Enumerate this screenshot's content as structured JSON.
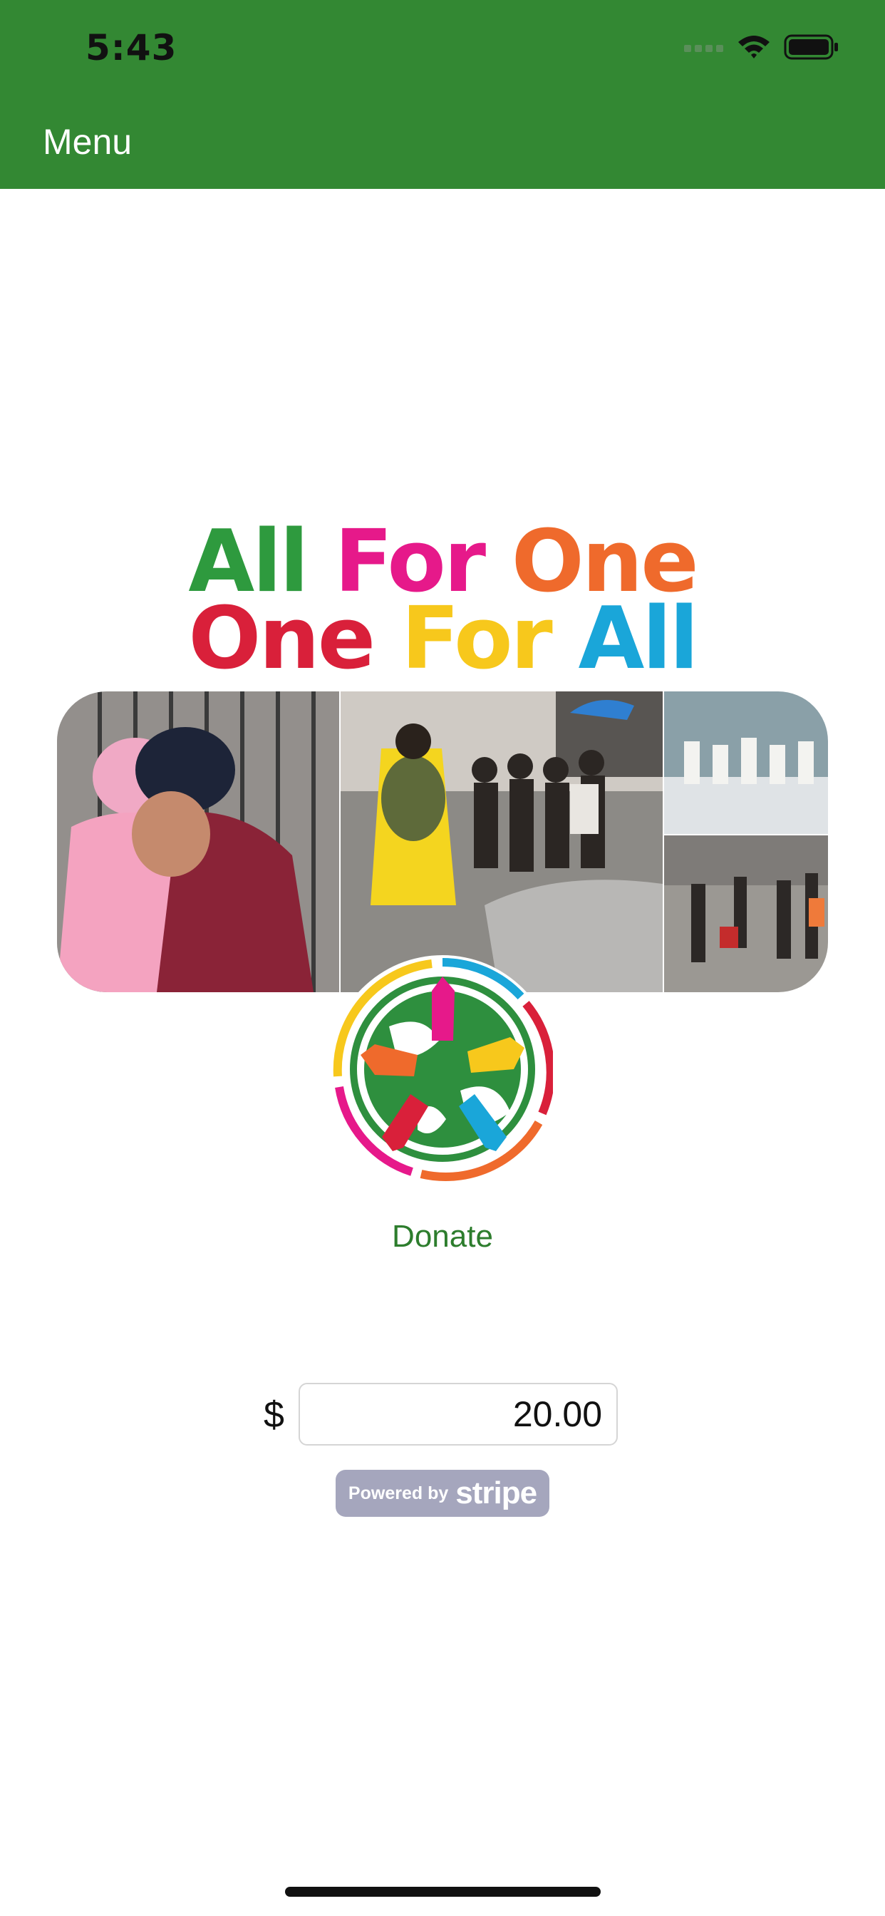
{
  "status_bar": {
    "time": "5:43"
  },
  "nav": {
    "menu_label": "Menu"
  },
  "banner": {
    "line1": [
      {
        "text": "All ",
        "color": "#2e9a3e"
      },
      {
        "text": "For ",
        "color": "#e6198a"
      },
      {
        "text": "One",
        "color": "#ef6a2c"
      }
    ],
    "line2": [
      {
        "text": "One ",
        "color": "#d9203a"
      },
      {
        "text": "For ",
        "color": "#f7c81c"
      },
      {
        "text": "All",
        "color": "#1aa6d9"
      }
    ]
  },
  "donate": {
    "label": "Donate"
  },
  "payment": {
    "currency_symbol": "$",
    "amount_value": "20.00"
  },
  "stripe_badge": {
    "prefix": "Powered by",
    "brand": "stripe"
  },
  "colors": {
    "header": "#338833",
    "donate_text": "#2d7d2d"
  }
}
